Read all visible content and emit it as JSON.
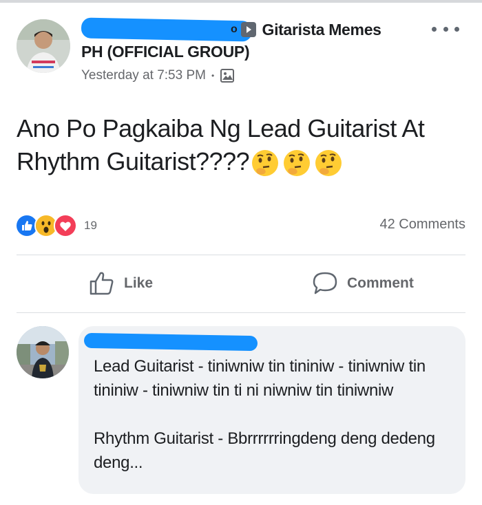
{
  "post": {
    "group_name": "Gitarista Memes",
    "group_suffix": "PH (OFFICIAL GROUP)",
    "author_tail": "o",
    "timestamp": "Yesterday at 7:53 PM",
    "separator": "•",
    "text": "Ano Po Pagkaiba Ng Lead Guitarist At Rhythm Guitarist????",
    "emoji": [
      "thinking-face",
      "thinking-face",
      "thinking-face"
    ]
  },
  "reactions": {
    "types": [
      "like",
      "wow",
      "love"
    ],
    "count": "19"
  },
  "comments_count": "42 Comments",
  "actions": {
    "like_label": "Like",
    "comment_label": "Comment"
  },
  "comment": {
    "text": "Lead Guitarist - tiniwniw tin tininiw - tiniwniw tin tininiw - tiniwniw tin ti ni niwniw tin tiniwniw\n\nRhythm Guitarist - Bbrrrrrringdeng deng dedeng deng..."
  },
  "colors": {
    "redaction": "#1591ff",
    "like_blue": "#1877f2",
    "love_red": "#f33e58",
    "wow_yellow": "#f7b928",
    "secondary_text": "#65676b"
  }
}
